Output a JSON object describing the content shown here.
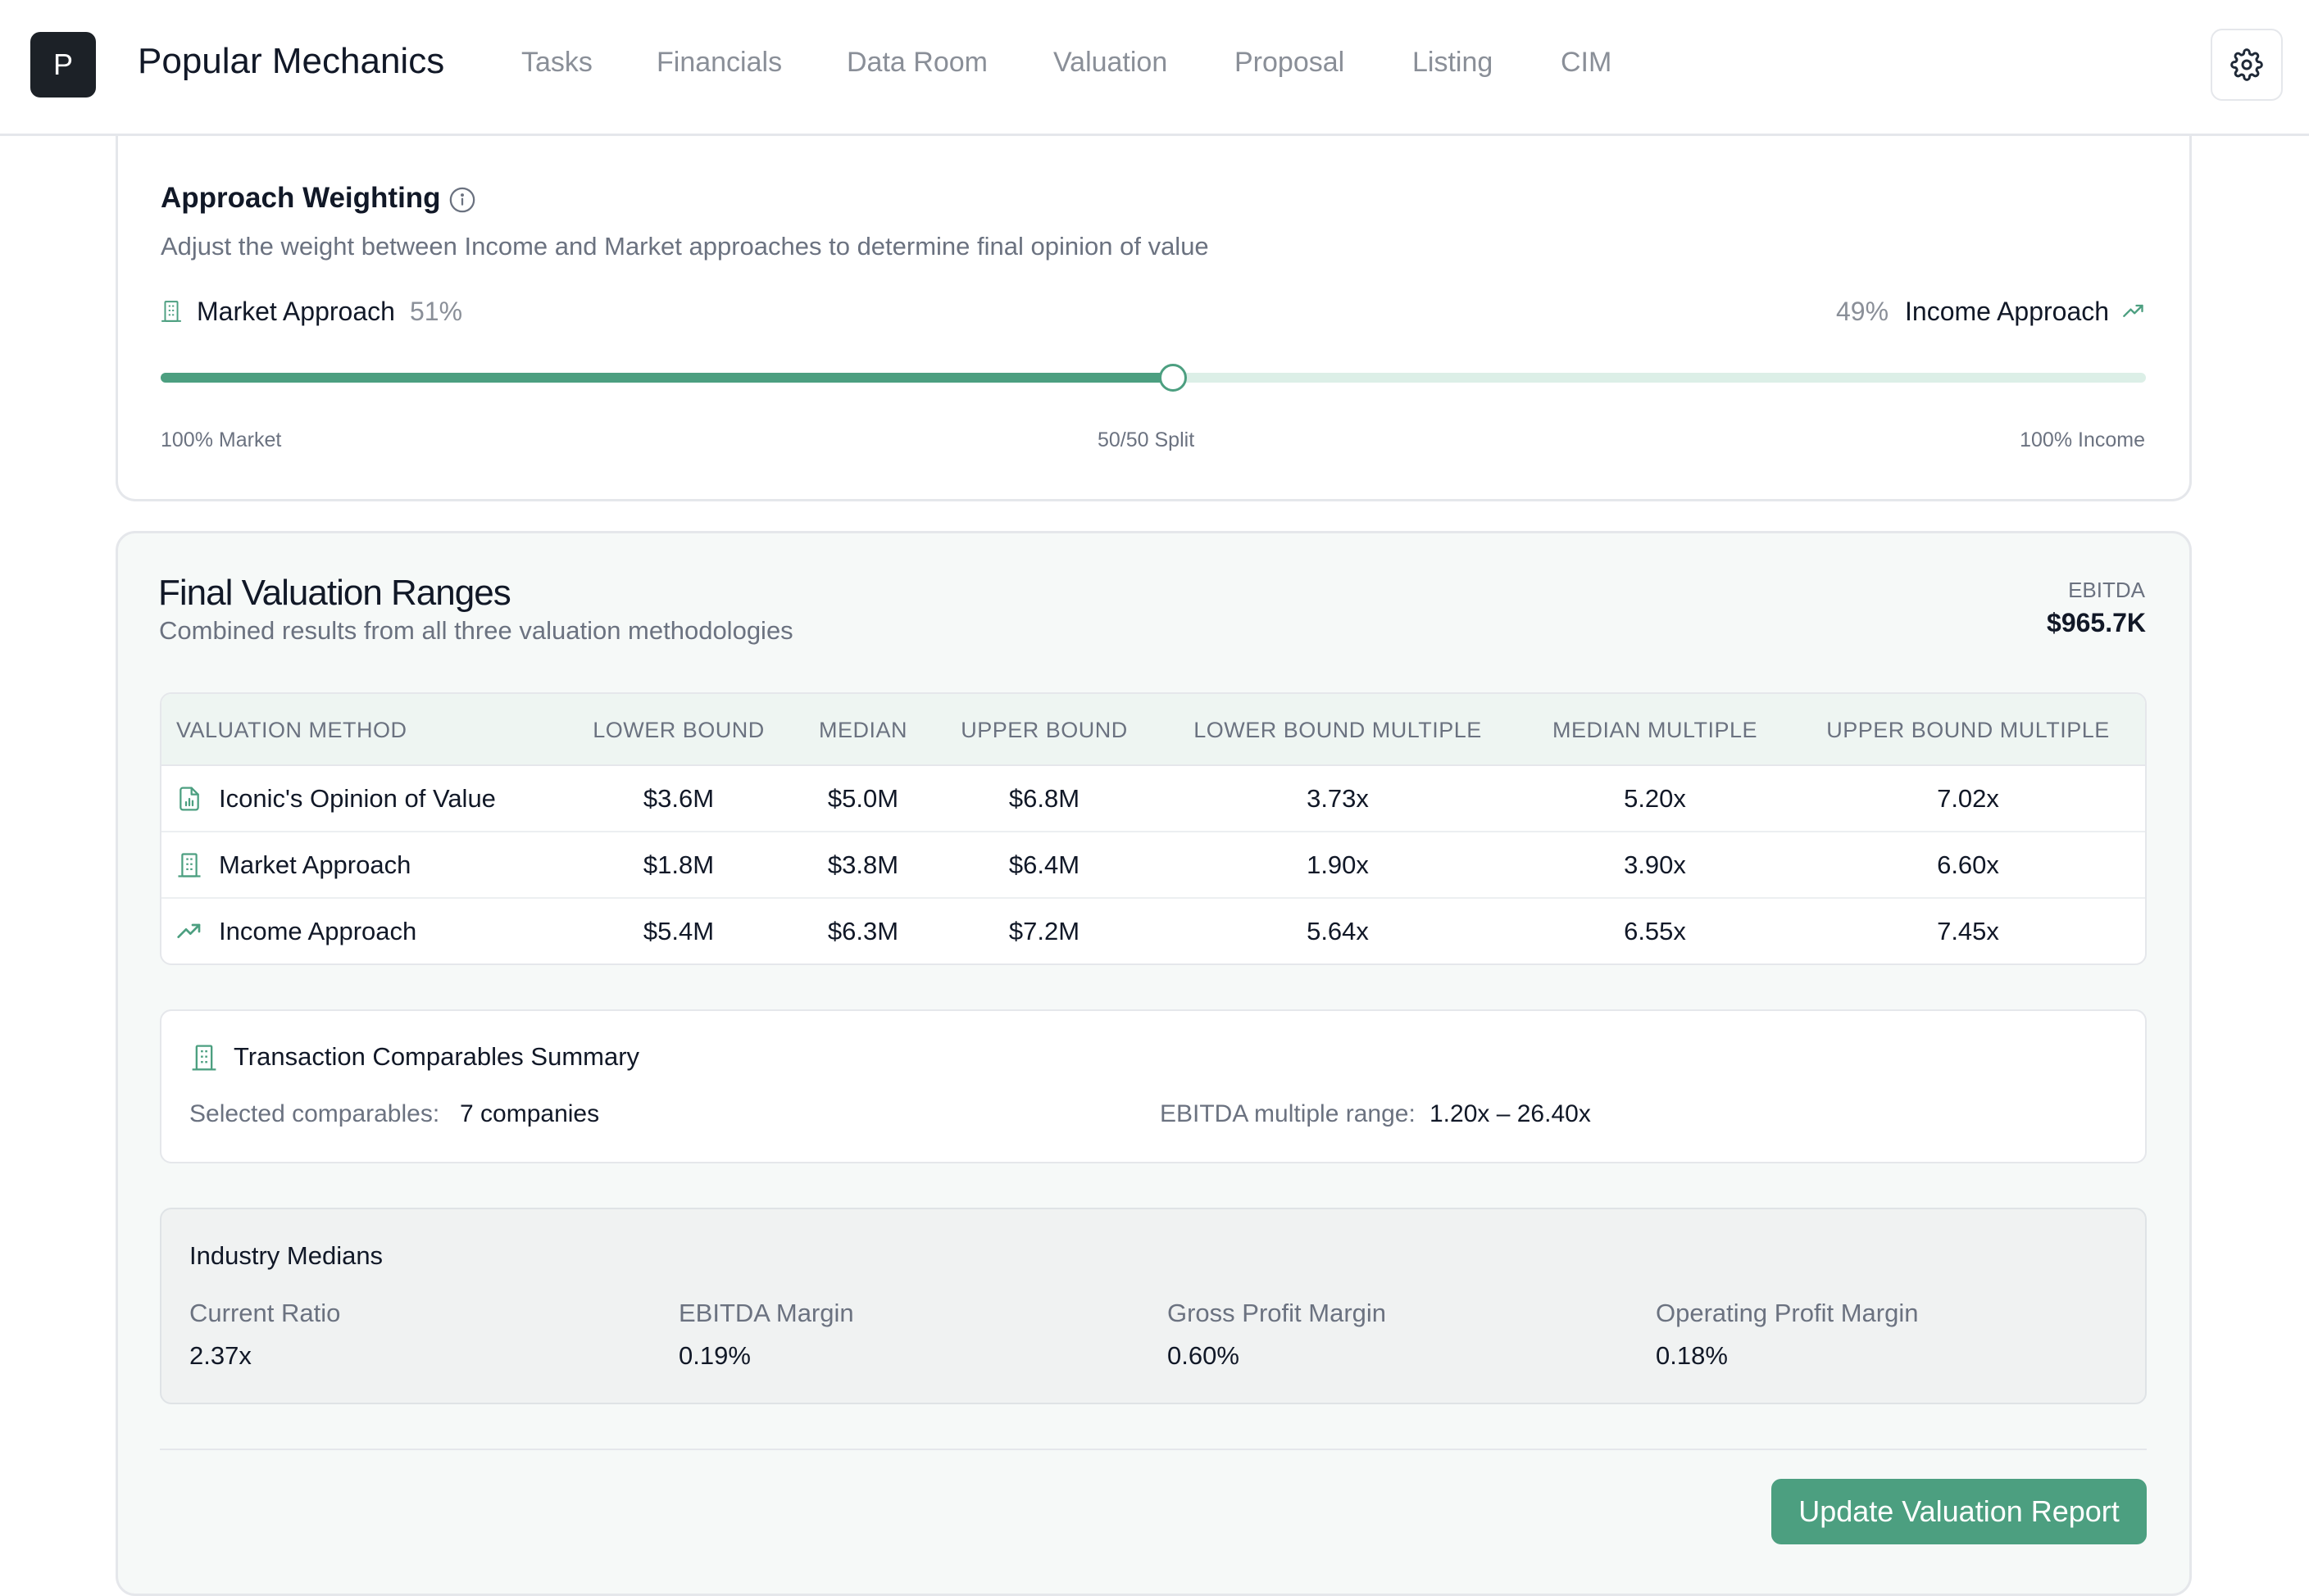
{
  "app": {
    "logo_letter": "P",
    "brand": "Popular Mechanics",
    "nav": [
      "Tasks",
      "Financials",
      "Data Room",
      "Valuation",
      "Proposal",
      "Listing",
      "CIM"
    ],
    "settings_icon": "gear-icon"
  },
  "approach_weighting": {
    "title": "Approach Weighting",
    "description": "Adjust the weight between Income and Market approaches to determine final opinion of value",
    "market_label": "Market Approach",
    "market_pct": "51%",
    "income_pct": "49%",
    "income_label": "Income Approach",
    "slider_value_market_fraction": 0.51,
    "tick_left": "100% Market",
    "tick_mid": "50/50 Split",
    "tick_right": "100% Income"
  },
  "final_valuation": {
    "title": "Final Valuation Ranges",
    "subtitle": "Combined results from all three valuation methodologies",
    "ebitda_label": "EBITDA",
    "ebitda_value": "$965.7K",
    "table": {
      "headers": [
        "VALUATION METHOD",
        "LOWER BOUND",
        "MEDIAN",
        "UPPER BOUND",
        "LOWER BOUND MULTIPLE",
        "MEDIAN MULTIPLE",
        "UPPER BOUND MULTIPLE"
      ],
      "rows": [
        {
          "icon": "report-icon",
          "method": "Iconic's Opinion of Value",
          "lower": "$3.6M",
          "median": "$5.0M",
          "upper": "$6.8M",
          "lower_mult": "3.73x",
          "median_mult": "5.20x",
          "upper_mult": "7.02x"
        },
        {
          "icon": "building-icon",
          "method": "Market Approach",
          "lower": "$1.8M",
          "median": "$3.8M",
          "upper": "$6.4M",
          "lower_mult": "1.90x",
          "median_mult": "3.90x",
          "upper_mult": "6.60x"
        },
        {
          "icon": "trending-up-icon",
          "method": "Income Approach",
          "lower": "$5.4M",
          "median": "$6.3M",
          "upper": "$7.2M",
          "lower_mult": "5.64x",
          "median_mult": "6.55x",
          "upper_mult": "7.45x"
        }
      ]
    },
    "transaction_comps": {
      "title": "Transaction Comparables Summary",
      "selected_label": "Selected comparables:",
      "selected_value": "7 companies",
      "range_label": "EBITDA multiple range:",
      "range_value": "1.20x – 26.40x"
    },
    "industry_medians": {
      "title": "Industry Medians",
      "items": [
        {
          "label": "Current Ratio",
          "value": "2.37x"
        },
        {
          "label": "EBITDA Margin",
          "value": "0.19%"
        },
        {
          "label": "Gross Profit Margin",
          "value": "0.60%"
        },
        {
          "label": "Operating Profit Margin",
          "value": "0.18%"
        }
      ]
    },
    "update_button": "Update Valuation Report"
  },
  "colors": {
    "accent": "#4c9f80",
    "track": "#dcefe7",
    "table_header_bg": "#eef5f2"
  }
}
